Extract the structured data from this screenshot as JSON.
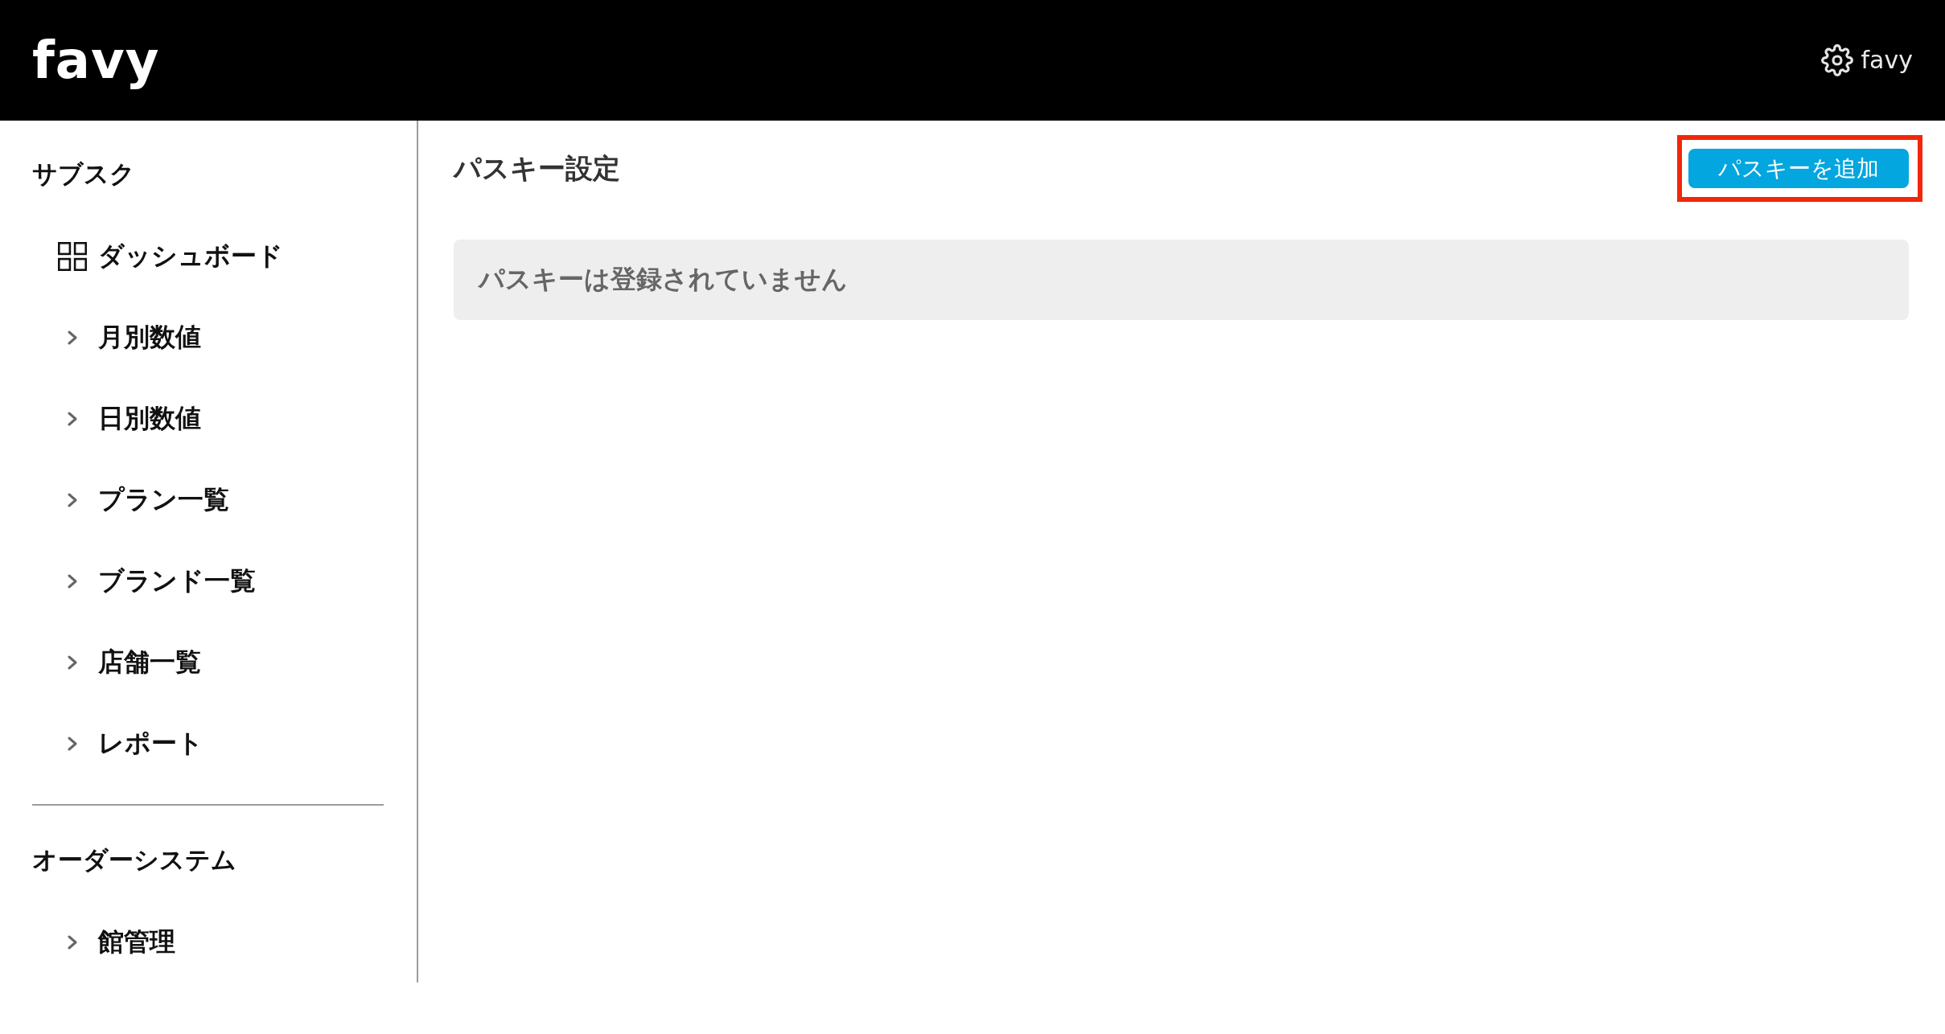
{
  "header": {
    "logo": "favy",
    "account": {
      "name": "favy"
    }
  },
  "sidebar": {
    "sections": [
      {
        "title": "サブスク",
        "items": [
          {
            "kind": "dashboard",
            "label": "ダッシュボード"
          },
          {
            "kind": "link",
            "label": "月別数値"
          },
          {
            "kind": "link",
            "label": "日別数値"
          },
          {
            "kind": "link",
            "label": "プラン一覧"
          },
          {
            "kind": "link",
            "label": "ブランド一覧"
          },
          {
            "kind": "link",
            "label": "店舗一覧"
          },
          {
            "kind": "link",
            "label": "レポート"
          }
        ]
      },
      {
        "title": "オーダーシステム",
        "items": [
          {
            "kind": "link",
            "label": "館管理"
          }
        ]
      }
    ]
  },
  "main": {
    "title": "パスキー設定",
    "add_button": {
      "label": "パスキーを追加",
      "highlighted": true
    },
    "empty_message": "パスキーは登録されていません"
  }
}
